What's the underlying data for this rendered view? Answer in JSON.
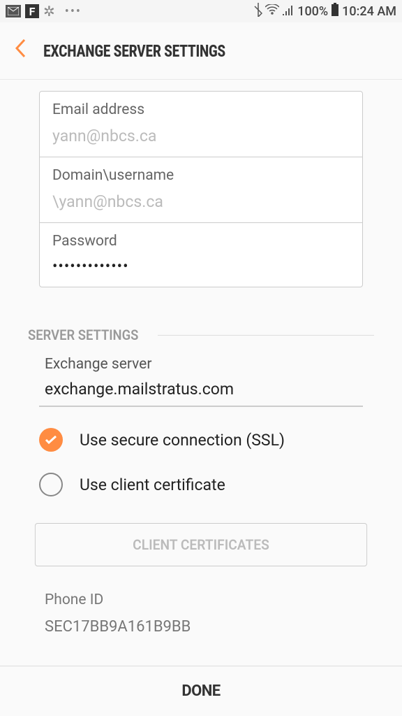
{
  "statusbar": {
    "battery_pct": "100%",
    "time": "10:24 AM"
  },
  "header": {
    "title": "EXCHANGE SERVER SETTINGS"
  },
  "fields": {
    "email_label": "Email address",
    "email_value": "yann@nbcs.ca",
    "domain_label": "Domain\\username",
    "domain_value": "\\yann@nbcs.ca",
    "password_label": "Password",
    "password_value": "•••••••••••••"
  },
  "section": {
    "title": "SERVER SETTINGS"
  },
  "server": {
    "label": "Exchange server",
    "value": "exchange.mailstratus.com"
  },
  "options": {
    "ssl_label": "Use secure connection (SSL)",
    "cert_label": "Use client certificate"
  },
  "cert_button": "CLIENT CERTIFICATES",
  "phone": {
    "label": "Phone ID",
    "value": "SEC17BB9A161B9BB"
  },
  "done": "DONE"
}
